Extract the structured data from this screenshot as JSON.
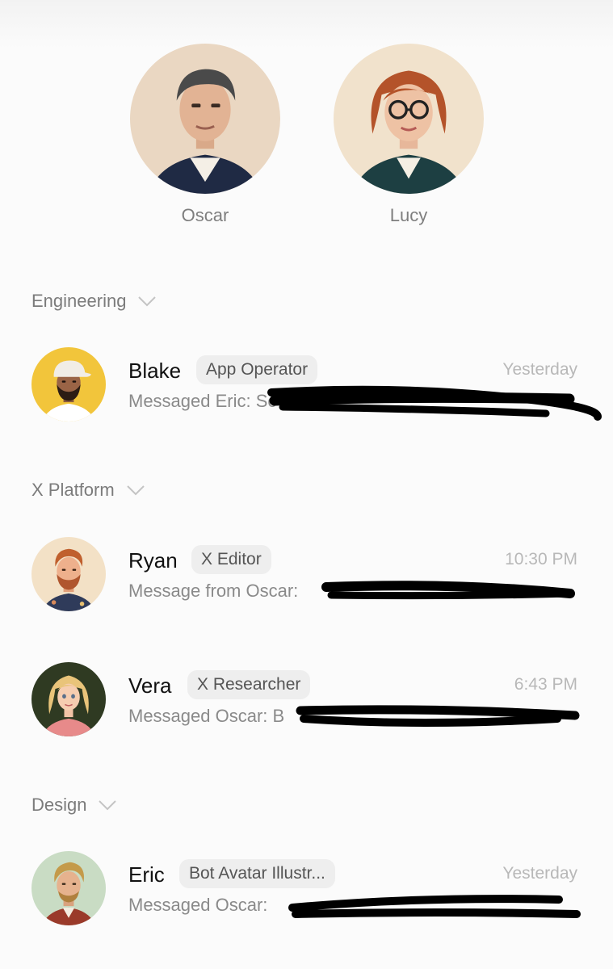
{
  "pinned": [
    {
      "name": "Oscar",
      "avatar_icon": "oscar-avatar-icon"
    },
    {
      "name": "Lucy",
      "avatar_icon": "lucy-avatar-icon"
    }
  ],
  "sections": [
    {
      "title": "Engineering",
      "chevron_icon": "chevron-down-icon"
    },
    {
      "title": "X Platform",
      "chevron_icon": "chevron-down-icon"
    },
    {
      "title": "Design",
      "chevron_icon": "chevron-down-icon"
    }
  ],
  "chats": [
    {
      "name": "Blake",
      "tag": "App Operator",
      "time": "Yesterday",
      "preview": "Messaged Eric: Sc",
      "avatar_icon": "blake-avatar-icon",
      "redacted": true
    },
    {
      "name": "Ryan",
      "tag": "X Editor",
      "time": "10:30 PM",
      "preview": "Message from Oscar:",
      "avatar_icon": "ryan-avatar-icon",
      "redacted": true
    },
    {
      "name": "Vera",
      "tag": "X Researcher",
      "time": "6:43 PM",
      "preview": "Messaged Oscar: B",
      "avatar_icon": "vera-avatar-icon",
      "redacted": true
    },
    {
      "name": "Eric",
      "tag": "Bot Avatar Illustr...",
      "time": "Yesterday",
      "preview": "Messaged Oscar:",
      "avatar_icon": "eric-avatar-icon",
      "redacted": true
    }
  ],
  "colors": {
    "background": "#fbfbfb",
    "tag_background": "#eeeeee",
    "section_text": "#7b7b7b",
    "time_text": "#b8b8b8",
    "redaction_ink": "#000000"
  }
}
